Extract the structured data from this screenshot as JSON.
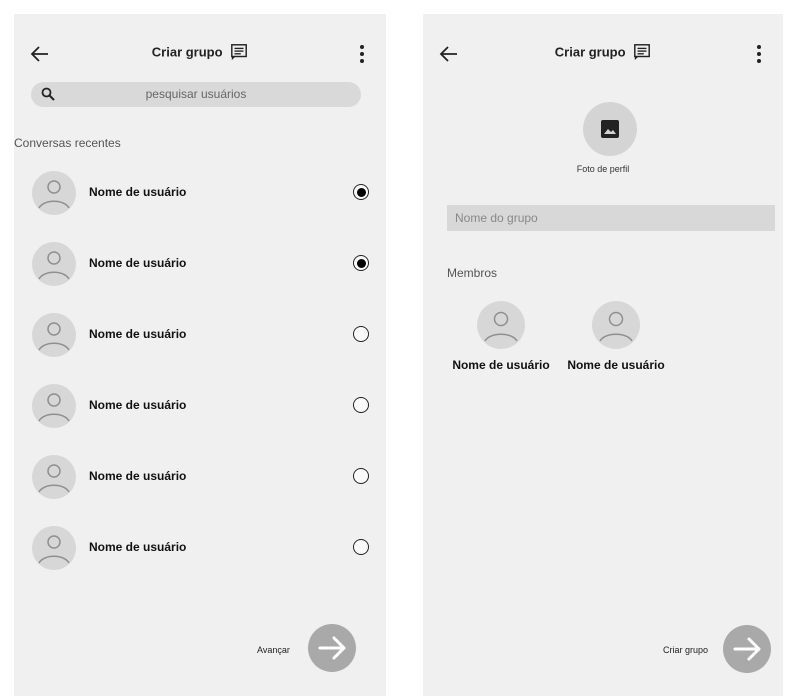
{
  "left_screen": {
    "header": {
      "title": "Criar grupo"
    },
    "search": {
      "placeholder": "pesquisar usuários"
    },
    "recent_label": "Conversas recentes",
    "contacts": [
      {
        "name": "Nome de usuário",
        "selected": true
      },
      {
        "name": "Nome de usuário",
        "selected": true
      },
      {
        "name": "Nome de usuário",
        "selected": false
      },
      {
        "name": "Nome de usuário",
        "selected": false
      },
      {
        "name": "Nome de usuário",
        "selected": false
      },
      {
        "name": "Nome de usuário",
        "selected": false
      }
    ],
    "next_label": "Avançar"
  },
  "right_screen": {
    "header": {
      "title": "Criar grupo"
    },
    "photo_label": "Foto de perfil",
    "group_name": {
      "placeholder": "Nome do grupo",
      "value": ""
    },
    "members_label": "Membros",
    "members": [
      {
        "name": "Nome de usuário"
      },
      {
        "name": "Nome de usuário"
      }
    ],
    "create_label": "Criar grupo"
  },
  "icons": [
    "arrow-back-icon",
    "chat-icon",
    "more-vert-icon",
    "search-icon",
    "person-icon",
    "image-icon",
    "arrow-forward-icon"
  ],
  "colors": {
    "screen_bg": "#f0f0f0",
    "fab": "#a9a9a9",
    "avatar": "#d7d7d7",
    "input": "#d8d8d8"
  }
}
